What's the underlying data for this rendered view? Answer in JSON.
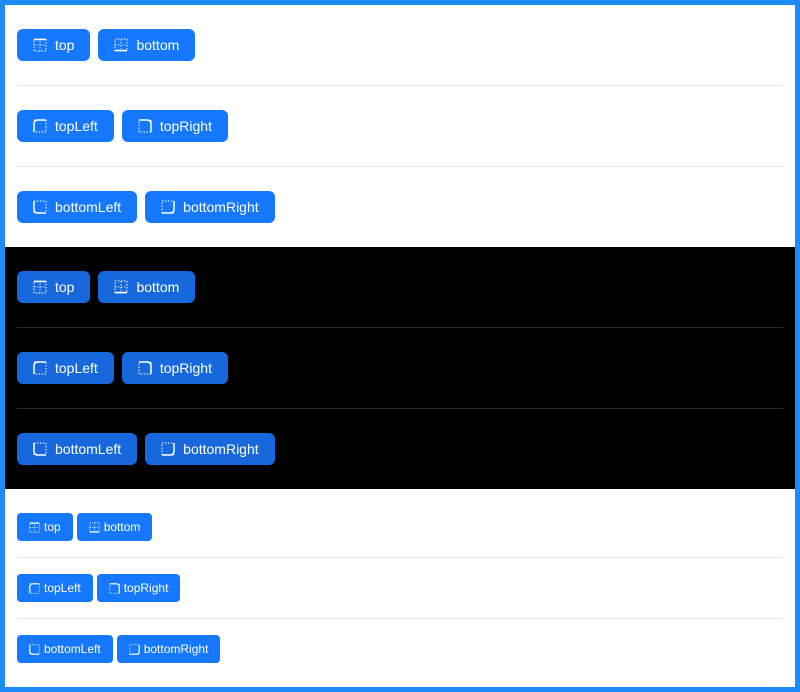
{
  "groups": [
    {
      "theme": "light",
      "rows": [
        [
          {
            "label": "top",
            "icon": "border-top-icon"
          },
          {
            "label": "bottom",
            "icon": "border-bottom-icon"
          }
        ],
        [
          {
            "label": "topLeft",
            "icon": "radius-upleft-icon"
          },
          {
            "label": "topRight",
            "icon": "radius-upright-icon"
          }
        ],
        [
          {
            "label": "bottomLeft",
            "icon": "radius-bottomleft-icon"
          },
          {
            "label": "bottomRight",
            "icon": "radius-bottomright-icon"
          }
        ]
      ]
    },
    {
      "theme": "dark",
      "rows": [
        [
          {
            "label": "top",
            "icon": "border-top-icon"
          },
          {
            "label": "bottom",
            "icon": "border-bottom-icon"
          }
        ],
        [
          {
            "label": "topLeft",
            "icon": "radius-upleft-icon"
          },
          {
            "label": "topRight",
            "icon": "radius-upright-icon"
          }
        ],
        [
          {
            "label": "bottomLeft",
            "icon": "radius-bottomleft-icon"
          },
          {
            "label": "bottomRight",
            "icon": "radius-bottomright-icon"
          }
        ]
      ]
    },
    {
      "theme": "light-small",
      "rows": [
        [
          {
            "label": "top",
            "icon": "border-top-icon"
          },
          {
            "label": "bottom",
            "icon": "border-bottom-icon"
          }
        ],
        [
          {
            "label": "topLeft",
            "icon": "radius-upleft-icon"
          },
          {
            "label": "topRight",
            "icon": "radius-upright-icon"
          }
        ],
        [
          {
            "label": "bottomLeft",
            "icon": "radius-bottomleft-icon"
          },
          {
            "label": "bottomRight",
            "icon": "radius-bottomright-icon"
          }
        ]
      ]
    }
  ],
  "colors": {
    "frame": "#1d8cf8",
    "primary": "#1677ff",
    "primary_dark": "#1668dc",
    "dark_bg": "#000000"
  }
}
